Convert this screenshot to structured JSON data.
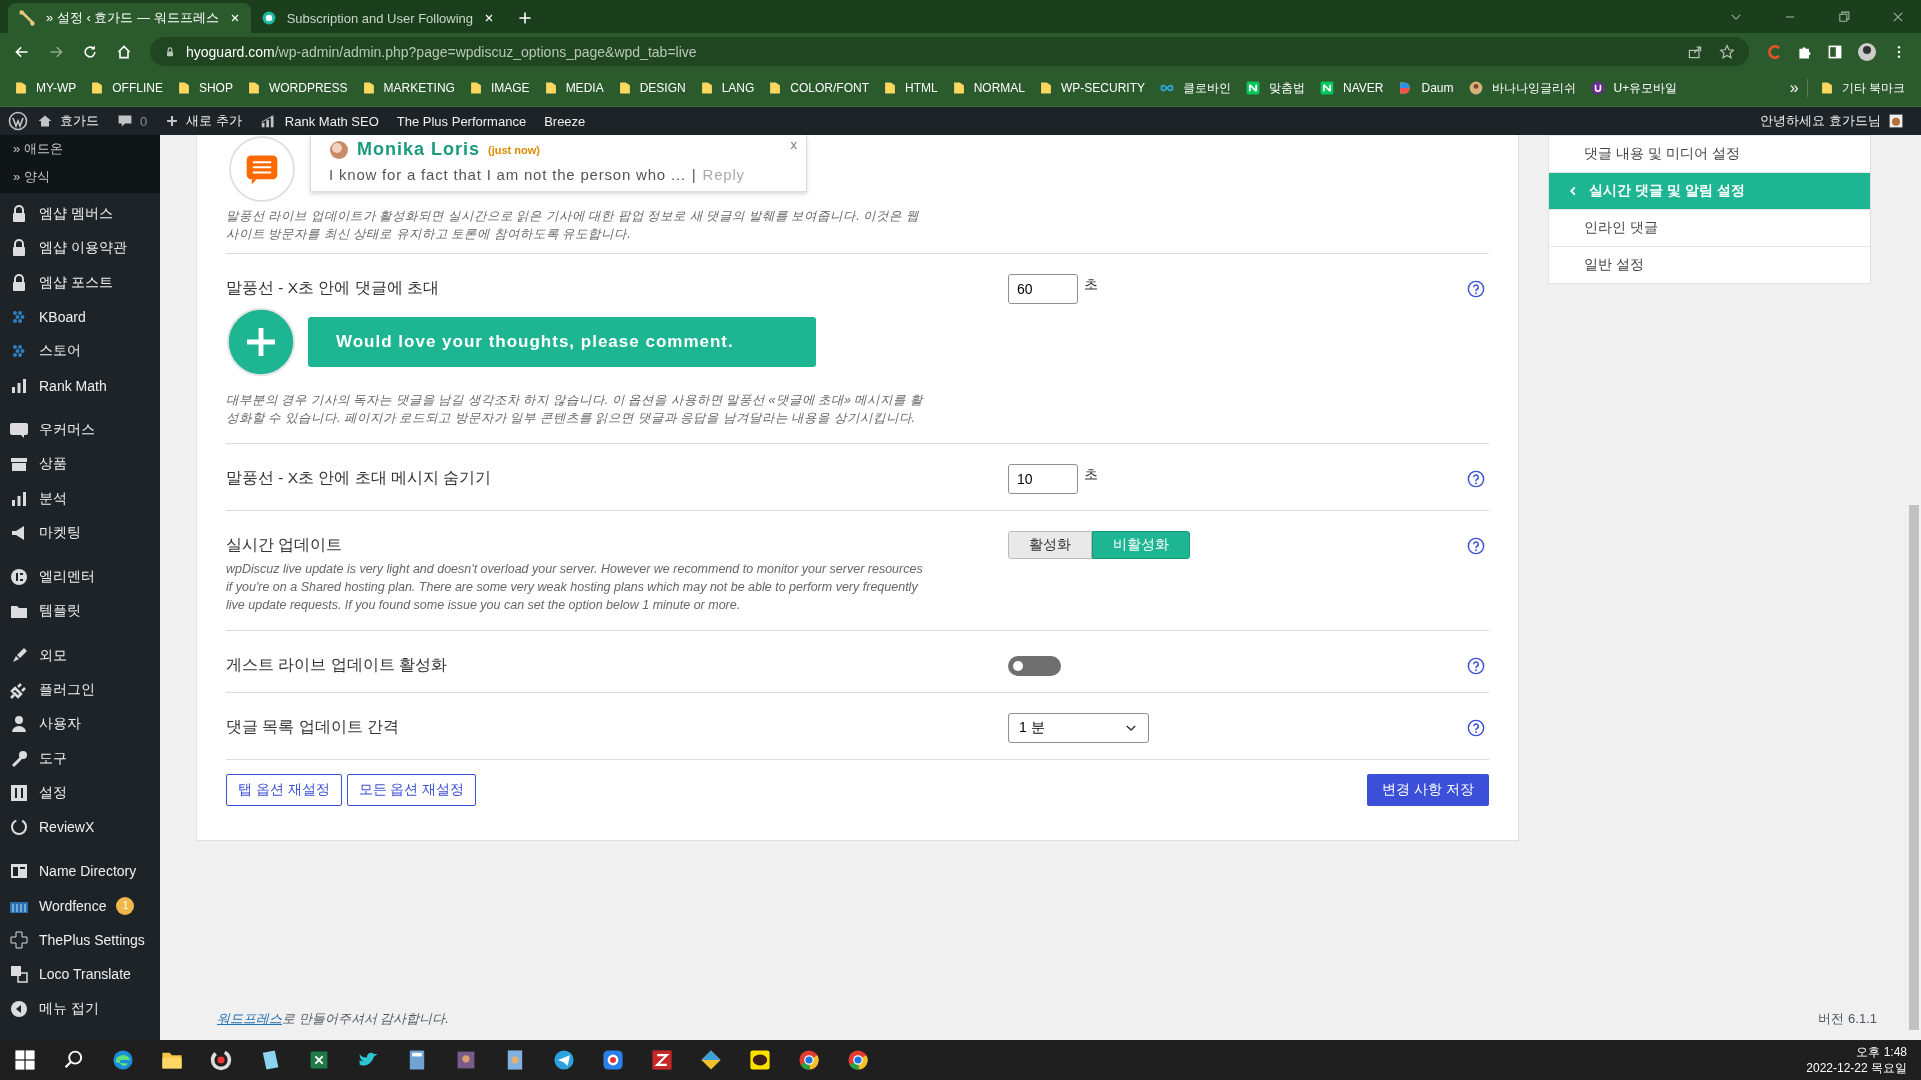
{
  "browser": {
    "tabs": [
      {
        "title": "» 설정 ‹ 효가드 — 워드프레스",
        "selected": true
      },
      {
        "title": "Subscription and User Following",
        "selected": false
      }
    ],
    "address": {
      "host": "hyoguard.com",
      "path": "/wp-admin/admin.php?page=wpdiscuz_options_page&wpd_tab=live"
    },
    "bookmarks": [
      {
        "label": "MY-WP",
        "kind": "folder"
      },
      {
        "label": "OFFLINE",
        "kind": "folder"
      },
      {
        "label": "SHOP",
        "kind": "folder"
      },
      {
        "label": "WORDPRESS",
        "kind": "folder"
      },
      {
        "label": "MARKETING",
        "kind": "folder"
      },
      {
        "label": "IMAGE",
        "kind": "folder"
      },
      {
        "label": "MEDIA",
        "kind": "folder"
      },
      {
        "label": "DESIGN",
        "kind": "folder"
      },
      {
        "label": "LANG",
        "kind": "folder"
      },
      {
        "label": "COLOR/FONT",
        "kind": "folder"
      },
      {
        "label": "HTML",
        "kind": "folder"
      },
      {
        "label": "NORMAL",
        "kind": "folder"
      },
      {
        "label": "WP-SECURITY",
        "kind": "folder"
      },
      {
        "label": "클로바인",
        "kind": "site"
      },
      {
        "label": "맞춤법",
        "kind": "site"
      },
      {
        "label": "NAVER",
        "kind": "site"
      },
      {
        "label": "Daum",
        "kind": "site"
      },
      {
        "label": "바나나잉글리쉬",
        "kind": "site"
      },
      {
        "label": "U+유모바일",
        "kind": "site"
      }
    ],
    "more": "»",
    "other_bookmarks": "기타 북마크"
  },
  "admin_bar": {
    "site": "효가드",
    "comments": "0",
    "new": "새로 추가",
    "items": [
      "Rank Math SEO",
      "The Plus Performance",
      "Breeze"
    ],
    "greeting": "안녕하세요 효가드님"
  },
  "sidebar": {
    "submenu": [
      "» 애드온",
      "» 양식"
    ],
    "groups": [
      [
        {
          "label": "엠샵 멤버스"
        },
        {
          "label": "엠샵 이용약관"
        },
        {
          "label": "엠샵 포스트"
        },
        {
          "label": "KBoard"
        },
        {
          "label": "스토어"
        },
        {
          "label": "Rank Math"
        }
      ],
      [
        {
          "label": "우커머스"
        },
        {
          "label": "상품"
        },
        {
          "label": "분석"
        },
        {
          "label": "마켓팅"
        }
      ],
      [
        {
          "label": "엘리멘터"
        },
        {
          "label": "템플릿"
        }
      ],
      [
        {
          "label": "외모"
        },
        {
          "label": "플러그인"
        },
        {
          "label": "사용자"
        },
        {
          "label": "도구"
        },
        {
          "label": "설정"
        },
        {
          "label": "ReviewX"
        }
      ],
      [
        {
          "label": "Name Directory"
        },
        {
          "label": "Wordfence",
          "badge": "1"
        },
        {
          "label": "ThePlus Settings"
        },
        {
          "label": "Loco Translate"
        },
        {
          "label": "메뉴 접기"
        }
      ]
    ]
  },
  "settings": [
    {
      "kind": "popup-preview",
      "author": "Monika Loris",
      "time": "(just now)",
      "excerpt": "I know for a fact that I am not the person who ...",
      "separator": "|",
      "reply": "Reply",
      "close": "x",
      "description": "말풍선 라이브 업데이트가 활성화되면 실시간으로 읽은 기사에 대한 팝업 정보로 새 댓글의 발췌를 보여줍니다. 이것은 웹사이트 방문자를 최신 상태로 유지하고 토론에 참여하도록 유도합니다."
    },
    {
      "kind": "number",
      "title": "말풍선 - X초 안에 댓글에 초대",
      "value": "60",
      "unit": "초",
      "banner": "Would love your thoughts, please comment.",
      "description": "대부분의 경우 기사의 독자는 댓글을 남길 생각조차 하지 않습니다. 이 옵션을 사용하면 말풍선 «댓글에 초대» 메시지를 활성화할 수 있습니다. 페이지가 로드되고 방문자가 일부 콘텐츠를 읽으면 댓글과 응답을 남겨달라는 내용을 상기시킵니다."
    },
    {
      "kind": "number",
      "title": "말풍선 - X초 안에 초대 메시지 숨기기",
      "value": "10",
      "unit": "초"
    },
    {
      "kind": "toggle-group",
      "title": "실시간 업데이트",
      "options": [
        {
          "label": "활성화",
          "selected": false
        },
        {
          "label": "비활성화",
          "selected": true
        }
      ],
      "description": "wpDiscuz live update is very light and doesn't overload your server. However we recommend to monitor your server resources if you're on a Shared hosting plan. There are some very weak hosting plans which may not be able to perform very frequently live update requests. If you found some issue you can set the option below 1 minute or more."
    },
    {
      "kind": "switch",
      "title": "게스트 라이브 업데이트 활성화",
      "on": false
    },
    {
      "kind": "select",
      "title": "댓글 목록 업데이트 간격",
      "value": "1 분"
    }
  ],
  "buttons": {
    "reset_tab": "탭 옵션 재설정",
    "reset_all": "모든 옵션 재설정",
    "save": "변경 사항 저장"
  },
  "right_nav": {
    "items": [
      {
        "label": "댓글 내용 및 미디어 설정",
        "selected": false
      },
      {
        "label": "실시간 댓글 및 알림 설정",
        "selected": true
      },
      {
        "label": "인라인 댓글",
        "selected": false
      },
      {
        "label": "일반 설정",
        "selected": false
      }
    ]
  },
  "footer": {
    "link": "워드프레스",
    "text": "로 만들어주셔서 감사합니다.",
    "version": "버전 6.1.1"
  },
  "taskbar": {
    "time": "오후 1:48",
    "date": "2022-12-22 목요일"
  }
}
